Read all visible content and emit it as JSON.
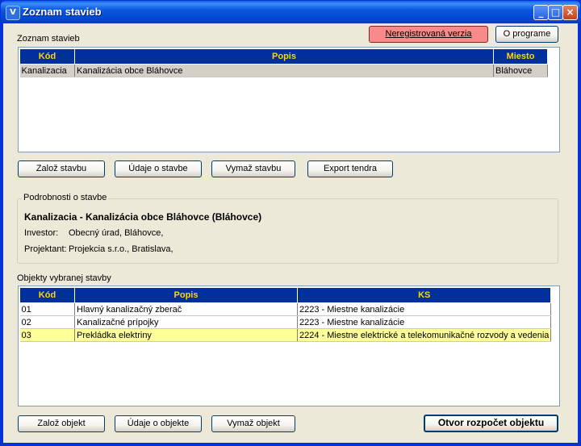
{
  "window": {
    "title": "Zoznam stavieb"
  },
  "header": {
    "section_label": "Zoznam stavieb",
    "unregistered_label": "Neregistrovaná verzia",
    "about_label": "O programe"
  },
  "buildings_table": {
    "columns": [
      "Kód",
      "Popis",
      "Miesto"
    ],
    "rows": [
      {
        "kod": "Kanalizacia",
        "popis": "Kanalizácia obce Bláhovce",
        "miesto": "Bláhovce"
      }
    ]
  },
  "building_buttons": {
    "create": "Založ stavbu",
    "info": "Údaje o stavbe",
    "delete": "Vymaž stavbu",
    "export": "Export tendra"
  },
  "details": {
    "legend": "Podrobnosti o stavbe",
    "heading": "Kanalizacia - Kanalizácia obce Bláhovce  (Bláhovce)",
    "investor_label": "Investor:",
    "investor_value": "Obecný úrad, Bláhovce,",
    "designer_label": "Projektant:",
    "designer_value": "Projekcia s.r.o., Bratislava,"
  },
  "objects": {
    "section_label": "Objekty vybranej stavby",
    "columns": [
      "Kód",
      "Popis",
      "KS"
    ],
    "rows": [
      {
        "kod": "01",
        "popis": "Hlavný kanalizačný zberač",
        "ks": "2223 - Miestne kanalizácie"
      },
      {
        "kod": "02",
        "popis": "Kanalizačné prípojky",
        "ks": "2223 - Miestne kanalizácie"
      },
      {
        "kod": "03",
        "popis": "Prekládka elektriny",
        "ks": "2224 - Miestne elektrické a telekomunikačné rozvody a vedenia"
      }
    ]
  },
  "object_buttons": {
    "create": "Založ objekt",
    "info": "Údaje o objekte",
    "delete": "Vymaž objekt",
    "open_budget": "Otvor rozpočet objektu"
  },
  "colors": {
    "header_bg": "#00309c",
    "header_text": "#ffd700",
    "selected_row_yellow": "#ffff99",
    "selected_row_gray": "#d4d0c8",
    "unregistered_button": "#f88a8a"
  }
}
